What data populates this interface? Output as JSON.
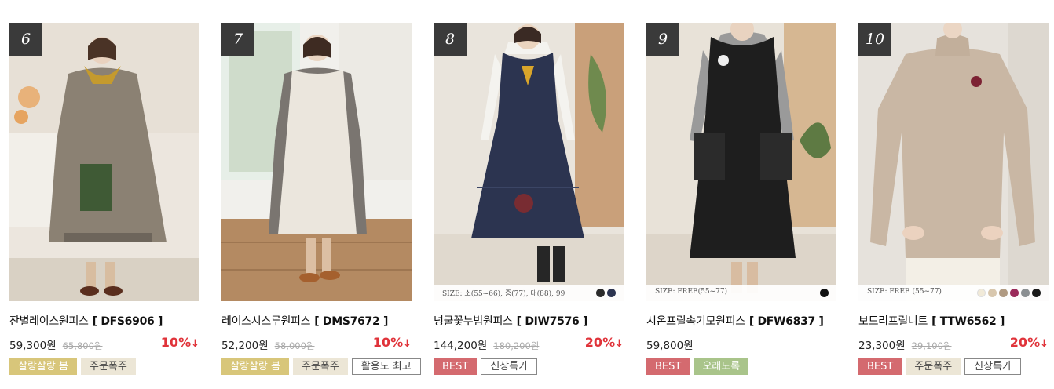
{
  "colors": {
    "discount": "#e0333a",
    "rank_bg": "#3a3a3a",
    "tag_yellow": "#d8c67a",
    "tag_beige": "#ece6d6",
    "tag_best": "#d46a6f",
    "tag_green": "#a9c48a"
  },
  "products": [
    {
      "rank": "6",
      "name": "잔별레이스원피스",
      "code": "[ DFS6906 ]",
      "price": "59,300원",
      "original_price": "65,800원",
      "discount": "10%",
      "discount_arrow": "↓",
      "size_text": "",
      "swatches": [],
      "tags": [
        {
          "label": "살랑살랑 봄",
          "style": "yellow"
        },
        {
          "label": "주문폭주",
          "style": "beige"
        }
      ]
    },
    {
      "rank": "7",
      "name": "레이스시스루원피스",
      "code": "[ DMS7672 ]",
      "price": "52,200원",
      "original_price": "58,000원",
      "discount": "10%",
      "discount_arrow": "↓",
      "size_text": "",
      "swatches": [],
      "tags": [
        {
          "label": "살랑살랑 봄",
          "style": "yellow"
        },
        {
          "label": "주문폭주",
          "style": "beige"
        },
        {
          "label": "활용도 최고",
          "style": "outline"
        }
      ]
    },
    {
      "rank": "8",
      "name": "넝쿨꽃누빔원피스",
      "code": "[ DIW7576 ]",
      "price": "144,200원",
      "original_price": "180,200원",
      "discount": "20%",
      "discount_arrow": "↓",
      "size_text": "SIZE: 소(55~66), 중(77), 대(88), 99",
      "swatches": [
        "#2b2b2b",
        "#2c3450"
      ],
      "tags": [
        {
          "label": "BEST",
          "style": "best"
        },
        {
          "label": "신상특가",
          "style": "outline"
        }
      ]
    },
    {
      "rank": "9",
      "name": "시온프릴속기모원피스",
      "code": "[ DFW6837 ]",
      "price": "59,800원",
      "original_price": "",
      "discount": "",
      "discount_arrow": "",
      "size_text": "SIZE: FREE(55~77)",
      "swatches": [
        "#111111"
      ],
      "tags": [
        {
          "label": "BEST",
          "style": "best"
        },
        {
          "label": "오래도록",
          "style": "green"
        }
      ]
    },
    {
      "rank": "10",
      "name": "보드리프릴니트",
      "code": "[ TTW6562 ]",
      "price": "23,300원",
      "original_price": "29,100원",
      "discount": "20%",
      "discount_arrow": "↓",
      "size_text": "SIZE: FREE (55~77)",
      "swatches": [
        "#f1ead8",
        "#d8c7ad",
        "#b09a82",
        "#9a2a5a",
        "#8b8f92",
        "#1a1a1a"
      ],
      "tags": [
        {
          "label": "BEST",
          "style": "best"
        },
        {
          "label": "주문폭주",
          "style": "beige"
        },
        {
          "label": "신상특가",
          "style": "outline"
        }
      ]
    }
  ]
}
